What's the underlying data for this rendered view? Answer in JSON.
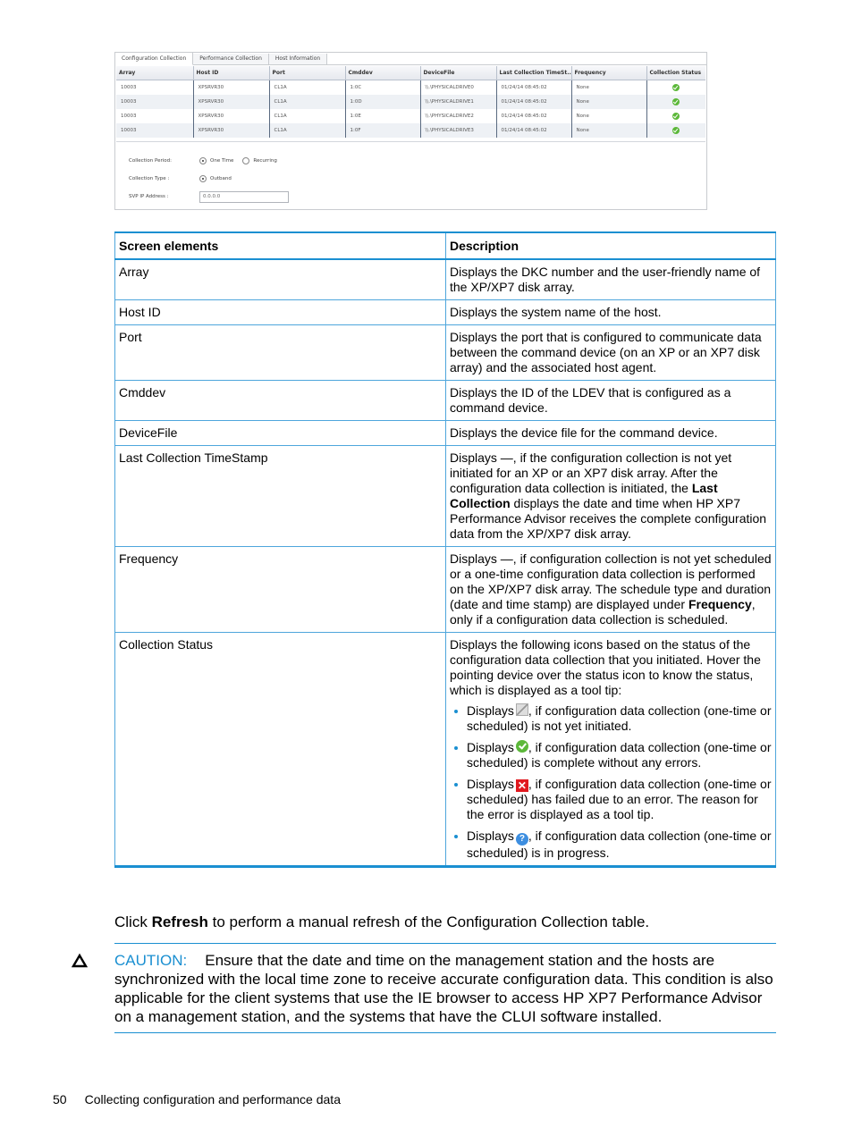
{
  "screenshot": {
    "tabs": [
      "Configuration Collection",
      "Performance Collection",
      "Host Information"
    ],
    "active_tab": "Configuration Collection",
    "columns": [
      "Array",
      "Host ID",
      "Port",
      "Cmddev",
      "DeviceFile",
      "Last Collection TimeSt...",
      "Frequency",
      "Collection Status"
    ],
    "rows": [
      {
        "array": "10003",
        "host_id": "XPSRVR30",
        "port": "CL1A",
        "cmddev": "1:0C",
        "devicefile": "\\\\.\\PHYSICALDRIVE0",
        "last_collection": "01/24/14 08:45:02",
        "frequency": "None",
        "status": "complete"
      },
      {
        "array": "10003",
        "host_id": "XPSRVR30",
        "port": "CL1A",
        "cmddev": "1:0D",
        "devicefile": "\\\\.\\PHYSICALDRIVE1",
        "last_collection": "01/24/14 08:45:02",
        "frequency": "None",
        "status": "complete"
      },
      {
        "array": "10003",
        "host_id": "XPSRVR30",
        "port": "CL1A",
        "cmddev": "1:0E",
        "devicefile": "\\\\.\\PHYSICALDRIVE2",
        "last_collection": "01/24/14 08:45:02",
        "frequency": "None",
        "status": "complete"
      },
      {
        "array": "10003",
        "host_id": "XPSRVR30",
        "port": "CL1A",
        "cmddev": "1:0F",
        "devicefile": "\\\\.\\PHYSICALDRIVE3",
        "last_collection": "01/24/14 08:45:02",
        "frequency": "None",
        "status": "complete"
      }
    ],
    "form": {
      "collection_period_label": "Collection Period:",
      "period_options": [
        "One Time",
        "Recurring"
      ],
      "period_selected": "One Time",
      "collection_type_label": "Collection Type :",
      "type_options": [
        "Outband"
      ],
      "type_selected": "Outband",
      "svp_ip_label": "SVP IP Address :",
      "svp_ip_value": "0.0.0.0"
    }
  },
  "doc_table": {
    "headers": [
      "Screen elements",
      "Description"
    ],
    "rows": [
      {
        "element": "Array",
        "description": "Displays the DKC number and the user-friendly name of the XP/XP7 disk array."
      },
      {
        "element": "Host ID",
        "description": "Displays the system name of the host."
      },
      {
        "element": "Port",
        "description": "Displays the port that is configured to communicate data between the command device (on an XP or an XP7 disk array) and the associated host agent."
      },
      {
        "element": "Cmddev",
        "description": "Displays the ID of the LDEV that is configured as a command device."
      },
      {
        "element": "DeviceFile",
        "description": "Displays the device file for the command device."
      },
      {
        "element": "Last Collection TimeStamp",
        "description_pre": "Displays —, if the configuration collection is not yet initiated for an XP or an XP7 disk array. After the configuration data collection is initiated, the ",
        "description_bold": "Last Collection",
        "description_post": " displays the date and time when HP XP7 Performance Advisor receives the complete configuration data from the XP/XP7 disk array."
      },
      {
        "element": "Frequency",
        "description_pre": "Displays —, if configuration collection is not yet scheduled or a one-time configuration data collection is performed on the XP/XP7 disk array. The schedule type and duration (date and time stamp) are displayed under ",
        "description_bold": "Frequency",
        "description_post": ", only if a configuration data collection is scheduled."
      },
      {
        "element": "Collection Status",
        "description": "Displays the following icons based on the status of the configuration data collection that you initiated. Hover the pointing device over the status icon to know the status, which is displayed as a tool tip:",
        "bullets": [
          {
            "prefix": "Displays",
            "icon": "pending-icon",
            "text": ", if configuration data collection (one-time or scheduled) is not yet initiated."
          },
          {
            "prefix": "Displays",
            "icon": "check-circle-icon",
            "text": ", if configuration data collection (one-time or scheduled) is complete without any errors."
          },
          {
            "prefix": "Displays",
            "icon": "error-x-icon",
            "text": ", if configuration data collection (one-time or scheduled) has failed due to an error. The reason for the error is displayed as a tool tip."
          },
          {
            "prefix": "Displays",
            "icon": "question-circle-icon",
            "text": ", if configuration data collection (one-time or scheduled) is in progress."
          }
        ]
      }
    ]
  },
  "refresh_paragraph": {
    "pre": "Click ",
    "bold": "Refresh",
    "post": " to perform a manual refresh of the Configuration Collection table."
  },
  "caution": {
    "label": "CAUTION:",
    "text": "Ensure that the date and time on the management station and the hosts are synchronized with the local time zone to receive accurate configuration data. This condition is also applicable for the client systems that use the IE browser to access HP XP7 Performance Advisor on a management station, and the systems that have the CLUI software installed."
  },
  "footer": {
    "page_number": "50",
    "section": "Collecting configuration and performance data"
  },
  "colors": {
    "accent": "#1a8fd1",
    "success": "#5cb83a",
    "error": "#e0191f",
    "info": "#3d8ee0"
  }
}
